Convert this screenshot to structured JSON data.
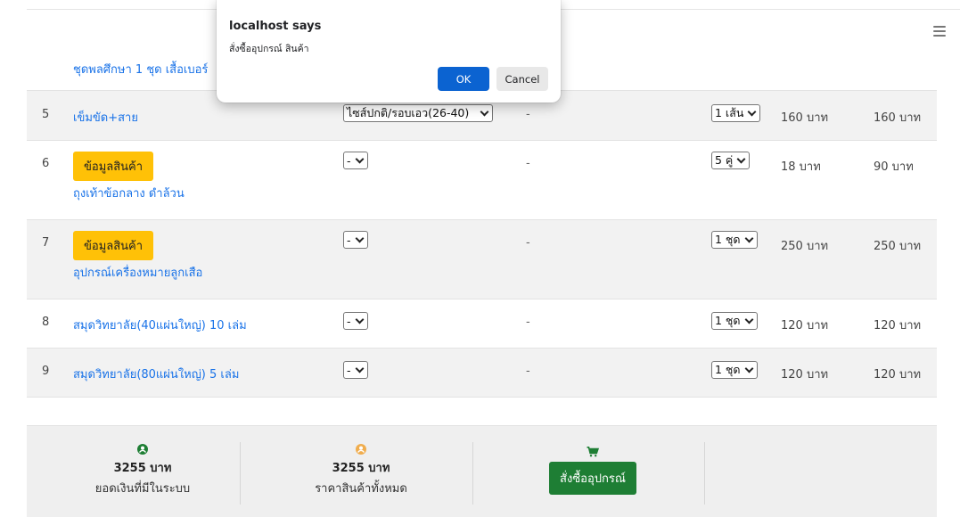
{
  "header": {
    "menu_icon": "hamburger-menu-icon"
  },
  "partial_row": {
    "name": "ชุดพลศึกษา 1 ชุด เสื้อเบอร์"
  },
  "rows": [
    {
      "no": "5",
      "name": "เข็มขัด+สาย",
      "size": "ไซส์ปกติ/รอบเอว(26-40)",
      "dash": "-",
      "qty": "1 เส้น",
      "unit_price": "160 บาท",
      "total": "160 บาท"
    },
    {
      "no": "6",
      "info_label": "ข้อมูลสินค้า",
      "name": "ถุงเท้าข้อกลาง ดำล้วน",
      "size": "-",
      "dash": "-",
      "qty": "5 คู่",
      "unit_price": "18 บาท",
      "total": "90 บาท"
    },
    {
      "no": "7",
      "info_label": "ข้อมูลสินค้า",
      "name": "อุปกรณ์เครื่องหมายลูกเสือ",
      "size": "-",
      "dash": "-",
      "qty": "1 ชุด",
      "unit_price": "250 บาท",
      "total": "250 บาท"
    },
    {
      "no": "8",
      "name": "สมุดวิทยาลัย(40แผ่นใหญ่) 10 เล่ม",
      "size": "-",
      "dash": "-",
      "qty": "1 ชุด",
      "unit_price": "120 บาท",
      "total": "120 บาท"
    },
    {
      "no": "9",
      "name": "สมุดวิทยาลัย(80แผ่นใหญ่) 5 เล่ม",
      "size": "-",
      "dash": "-",
      "qty": "1 ชุด",
      "unit_price": "120 บาท",
      "total": "120 บาท"
    }
  ],
  "footer": {
    "balance_amount": "3255 บาท",
    "balance_label": "ยอดเงินที่มีในระบบ",
    "total_amount": "3255 บาท",
    "total_label": "ราคาสินค้าทั้งหมด",
    "order_button": "สั่งซื้ออุปกรณ์",
    "colors": {
      "balance_icon": "#1e7e34",
      "total_icon": "#f0ad4e",
      "cart_icon": "#1e7e34"
    }
  },
  "dialog": {
    "title": "localhost says",
    "message": "สั่งซื้ออุปกรณ์ สินค้า",
    "ok_label": "OK",
    "cancel_label": "Cancel",
    "ok_color": "#0b63d1"
  }
}
